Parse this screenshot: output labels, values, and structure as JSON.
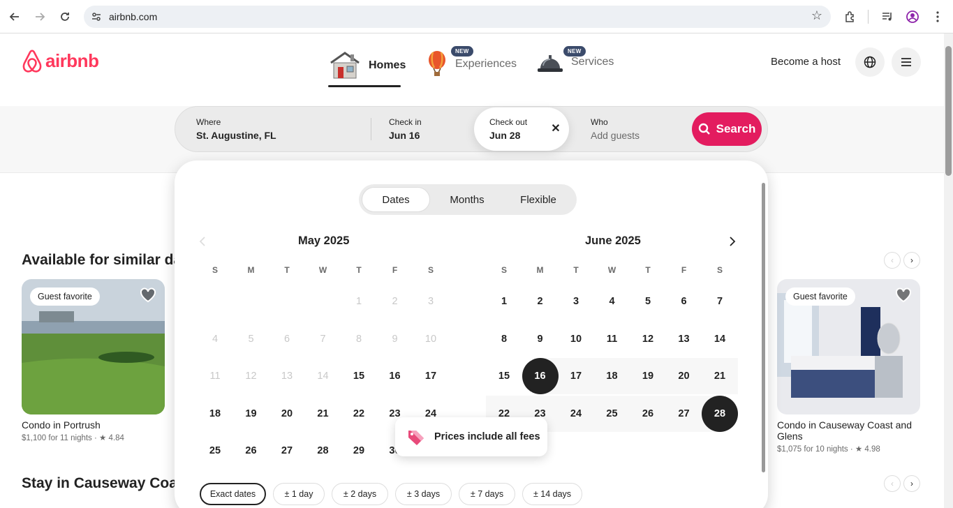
{
  "browser": {
    "url": "airbnb.com"
  },
  "header": {
    "logo_text": "airbnb",
    "categories": [
      {
        "label": "Homes",
        "badge": ""
      },
      {
        "label": "Experiences",
        "badge": "NEW"
      },
      {
        "label": "Services",
        "badge": "NEW"
      }
    ],
    "become_host": "Become a host"
  },
  "search": {
    "where_label": "Where",
    "where_value": "St. Augustine, FL",
    "checkin_label": "Check in",
    "checkin_value": "Jun 16",
    "checkout_label": "Check out",
    "checkout_value": "Jun 28",
    "who_label": "Who",
    "who_placeholder": "Add guests",
    "search_button": "Search"
  },
  "date_picker": {
    "tabs": [
      "Dates",
      "Months",
      "Flexible"
    ],
    "selected_tab": "Dates",
    "weekdays": [
      "S",
      "M",
      "T",
      "W",
      "T",
      "F",
      "S"
    ],
    "months": [
      {
        "title": "May 2025",
        "first_weekday": 4,
        "days": 31,
        "last_past_day": 14
      },
      {
        "title": "June 2025",
        "first_weekday": 0,
        "days": 30,
        "last_past_day": 0
      }
    ],
    "selected_start": "16",
    "selected_end": "28",
    "tooltip": "Prices include all fees",
    "flex_chips": [
      "Exact dates",
      "± 1 day",
      "± 2 days",
      "± 3 days",
      "± 7 days",
      "± 14 days"
    ]
  },
  "sections": [
    {
      "title": "Available for similar dates"
    },
    {
      "title": "Stay in Causeway Coast"
    }
  ],
  "listings": [
    {
      "badge": "Guest favorite",
      "title": "Condo in Portrush",
      "price": "$1,100 for 11 nights",
      "rating": "4.84"
    },
    {
      "badge": "Guest favorite",
      "title": "Condo in Causeway Coast and Glens",
      "price": "$1,075 for 10 nights",
      "rating": "4.98"
    }
  ],
  "colors": {
    "brand": "#ff385c",
    "search_button": "#e31c5f",
    "selected_day": "#222222"
  }
}
